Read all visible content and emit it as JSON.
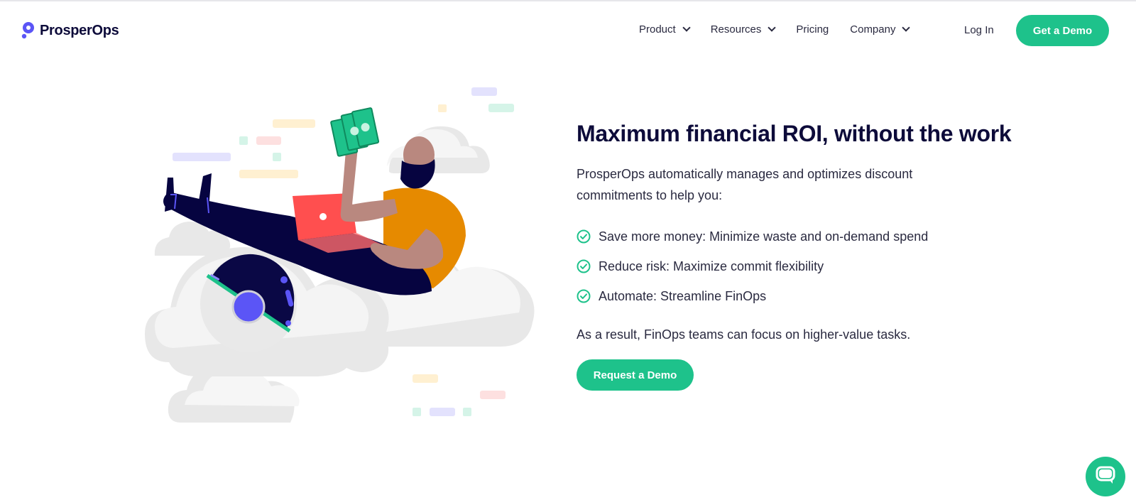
{
  "brand": {
    "name": "ProsperOps",
    "accent_color": "#1ec28b",
    "logo_color": "#5b55f6",
    "text_color": "#0d0b3a"
  },
  "nav": {
    "items": [
      {
        "label": "Product",
        "has_dropdown": true
      },
      {
        "label": "Resources",
        "has_dropdown": true
      },
      {
        "label": "Pricing",
        "has_dropdown": false
      },
      {
        "label": "Company",
        "has_dropdown": true
      }
    ],
    "login_label": "Log In",
    "cta_label": "Get a Demo"
  },
  "hero": {
    "title": "Maximum financial ROI, without the work",
    "intro": "ProsperOps automatically manages and optimizes discount commitments to help you:",
    "bullets": [
      "Save more money: Minimize waste and on-demand spend",
      "Reduce risk: Maximize commit flexibility",
      "Automate: Streamline FinOps"
    ],
    "result": "As a result, FinOps teams can focus on higher-value tasks.",
    "cta_label": "Request a Demo",
    "illustration_icon": "person-on-cloud-illustration"
  },
  "chat": {
    "icon": "chat-bubble-icon"
  }
}
